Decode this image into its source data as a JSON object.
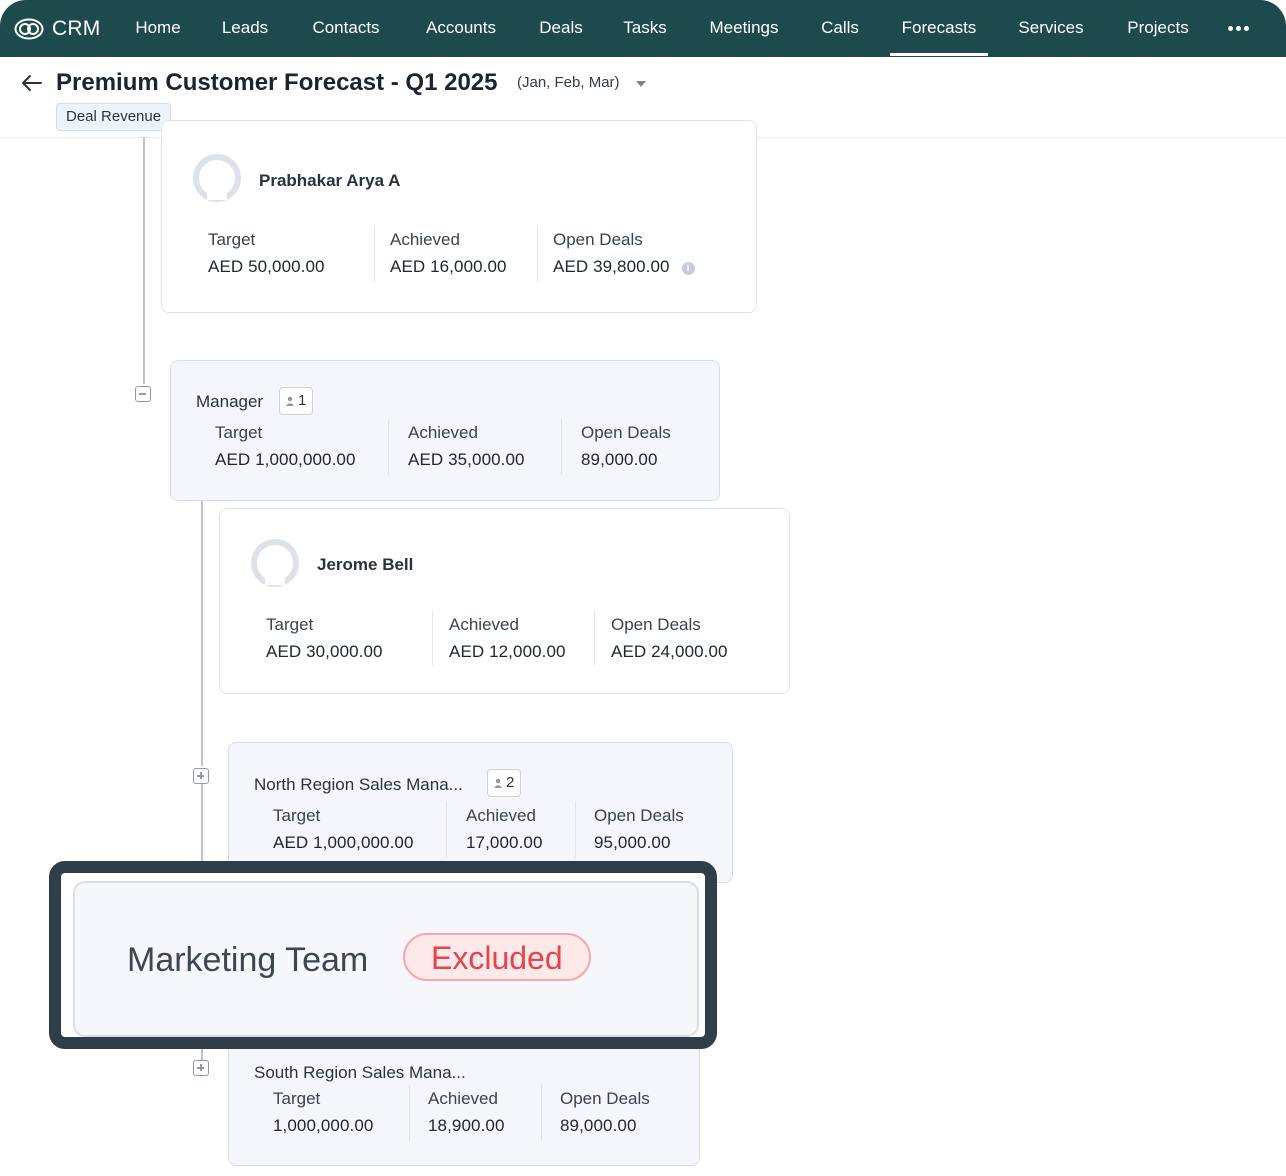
{
  "nav": {
    "brand": "CRM",
    "items": [
      "Home",
      "Leads",
      "Contacts",
      "Accounts",
      "Deals",
      "Tasks",
      "Meetings",
      "Calls",
      "Forecasts",
      "Services",
      "Projects"
    ],
    "active": "Forecasts",
    "more_icon": "ellipsis-icon"
  },
  "header": {
    "title": "Premium Customer Forecast  - Q1 2025",
    "range": "(Jan, Feb, Mar)",
    "tag": "Deal Revenue"
  },
  "labels": {
    "target": "Target",
    "achieved": "Achieved",
    "open_deals": "Open Deals"
  },
  "cards": {
    "prabhakar": {
      "name": "Prabhakar Arya A",
      "target": "AED 50,000.00",
      "achieved": "AED 16,000.00",
      "open_deals": "AED 39,800.00"
    },
    "manager": {
      "name": "Manager",
      "count": "1",
      "target": "AED 1,000,000.00",
      "achieved": "AED 35,000.00",
      "open_deals": "89,000.00"
    },
    "jerome": {
      "name": "Jerome Bell",
      "target": "AED 30,000.00",
      "achieved": "AED 12,000.00",
      "open_deals": "AED 24,000.00"
    },
    "north": {
      "name": "North Region Sales Mana...",
      "count": "2",
      "target": "AED 1,000,000.00",
      "achieved": "17,000.00",
      "open_deals": "95,000.00"
    },
    "south": {
      "name": "South Region Sales Mana...",
      "target": "1,000,000.00",
      "achieved": "18,900.00",
      "open_deals": "89,000.00"
    }
  },
  "highlight": {
    "name": "Marketing Team",
    "status": "Excluded"
  },
  "colors": {
    "nav_bg": "#1d4b4d",
    "excluded_text": "#e8434b",
    "excluded_bg": "#fde9ea",
    "highlight_border": "#2f3e48"
  }
}
